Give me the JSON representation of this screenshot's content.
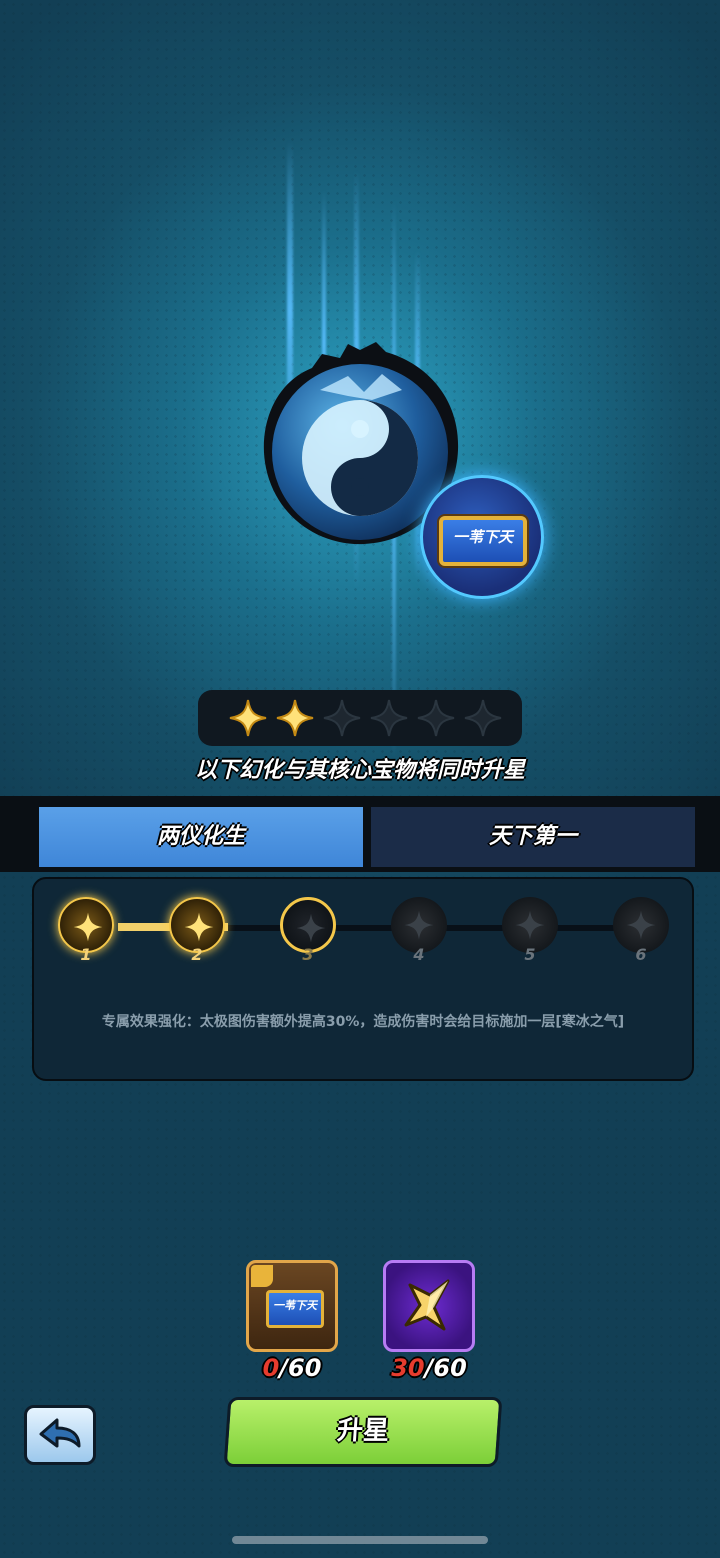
{
  "treasure": {
    "plaque_text": "一苇下天"
  },
  "stars": {
    "filled": 2,
    "total": 6
  },
  "subtitle": "以下幻化与其核心宝物将同时升星",
  "tabs": [
    {
      "label": "两仪化生",
      "active": true
    },
    {
      "label": "天下第一",
      "active": false
    }
  ],
  "progress": {
    "nodes": [
      {
        "label": "1",
        "state": "done"
      },
      {
        "label": "2",
        "state": "done"
      },
      {
        "label": "3",
        "state": "current"
      },
      {
        "label": "4",
        "state": "locked"
      },
      {
        "label": "5",
        "state": "locked"
      },
      {
        "label": "6",
        "state": "locked"
      }
    ],
    "description": "专属效果强化：太极图伤害额外提高30%，造成伤害时会给目标施加一层[寒冰之气]"
  },
  "costs": {
    "fragment": {
      "have": "0",
      "need": "/60",
      "plaque_text": "一苇下天"
    },
    "shard": {
      "have": "30",
      "need": "/60"
    }
  },
  "upgrade_label": "升星",
  "colors": {
    "accent": "#f4c74a",
    "tab_active": "#4a93e0",
    "button": "#8fdc48",
    "have_red": "#e63c2e"
  }
}
